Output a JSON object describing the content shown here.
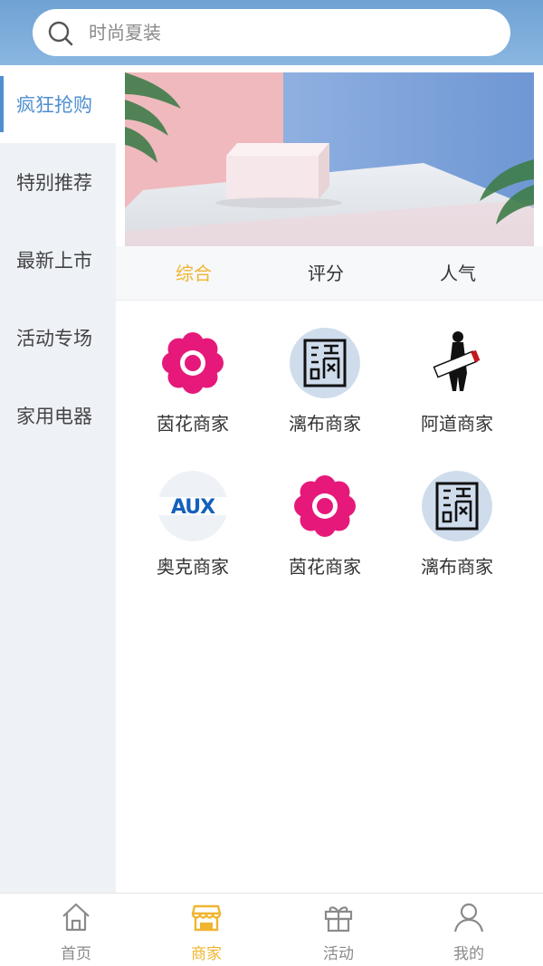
{
  "search": {
    "placeholder": "时尚夏装"
  },
  "sidebar": {
    "items": [
      {
        "label": "疯狂抢购",
        "active": true
      },
      {
        "label": "特别推荐",
        "active": false
      },
      {
        "label": "最新上市",
        "active": false
      },
      {
        "label": "活动专场",
        "active": false
      },
      {
        "label": "家用电器",
        "active": false
      }
    ]
  },
  "tabs": [
    {
      "label": "综合",
      "active": true
    },
    {
      "label": "评分",
      "active": false
    },
    {
      "label": "人气",
      "active": false
    }
  ],
  "merchants": [
    {
      "name": "茵花商家",
      "logo": "pink-flower-logo"
    },
    {
      "name": "漓布商家",
      "logo": "seal-stamp-logo"
    },
    {
      "name": "阿道商家",
      "logo": "adolph-figure-logo"
    },
    {
      "name": "奥克商家",
      "logo": "aux-logo",
      "logo_text": "AUX"
    },
    {
      "name": "茵花商家",
      "logo": "pink-flower-logo"
    },
    {
      "name": "漓布商家",
      "logo": "seal-stamp-logo"
    }
  ],
  "tabbar": [
    {
      "label": "首页",
      "icon": "home-icon",
      "active": false
    },
    {
      "label": "商家",
      "icon": "store-icon",
      "active": true
    },
    {
      "label": "活动",
      "icon": "gift-icon",
      "active": false
    },
    {
      "label": "我的",
      "icon": "user-icon",
      "active": false
    }
  ],
  "colors": {
    "accent": "#f0b530",
    "header": "#7aaad9",
    "sidebar_active": "#4f8fd0",
    "flower": "#e6197a"
  }
}
